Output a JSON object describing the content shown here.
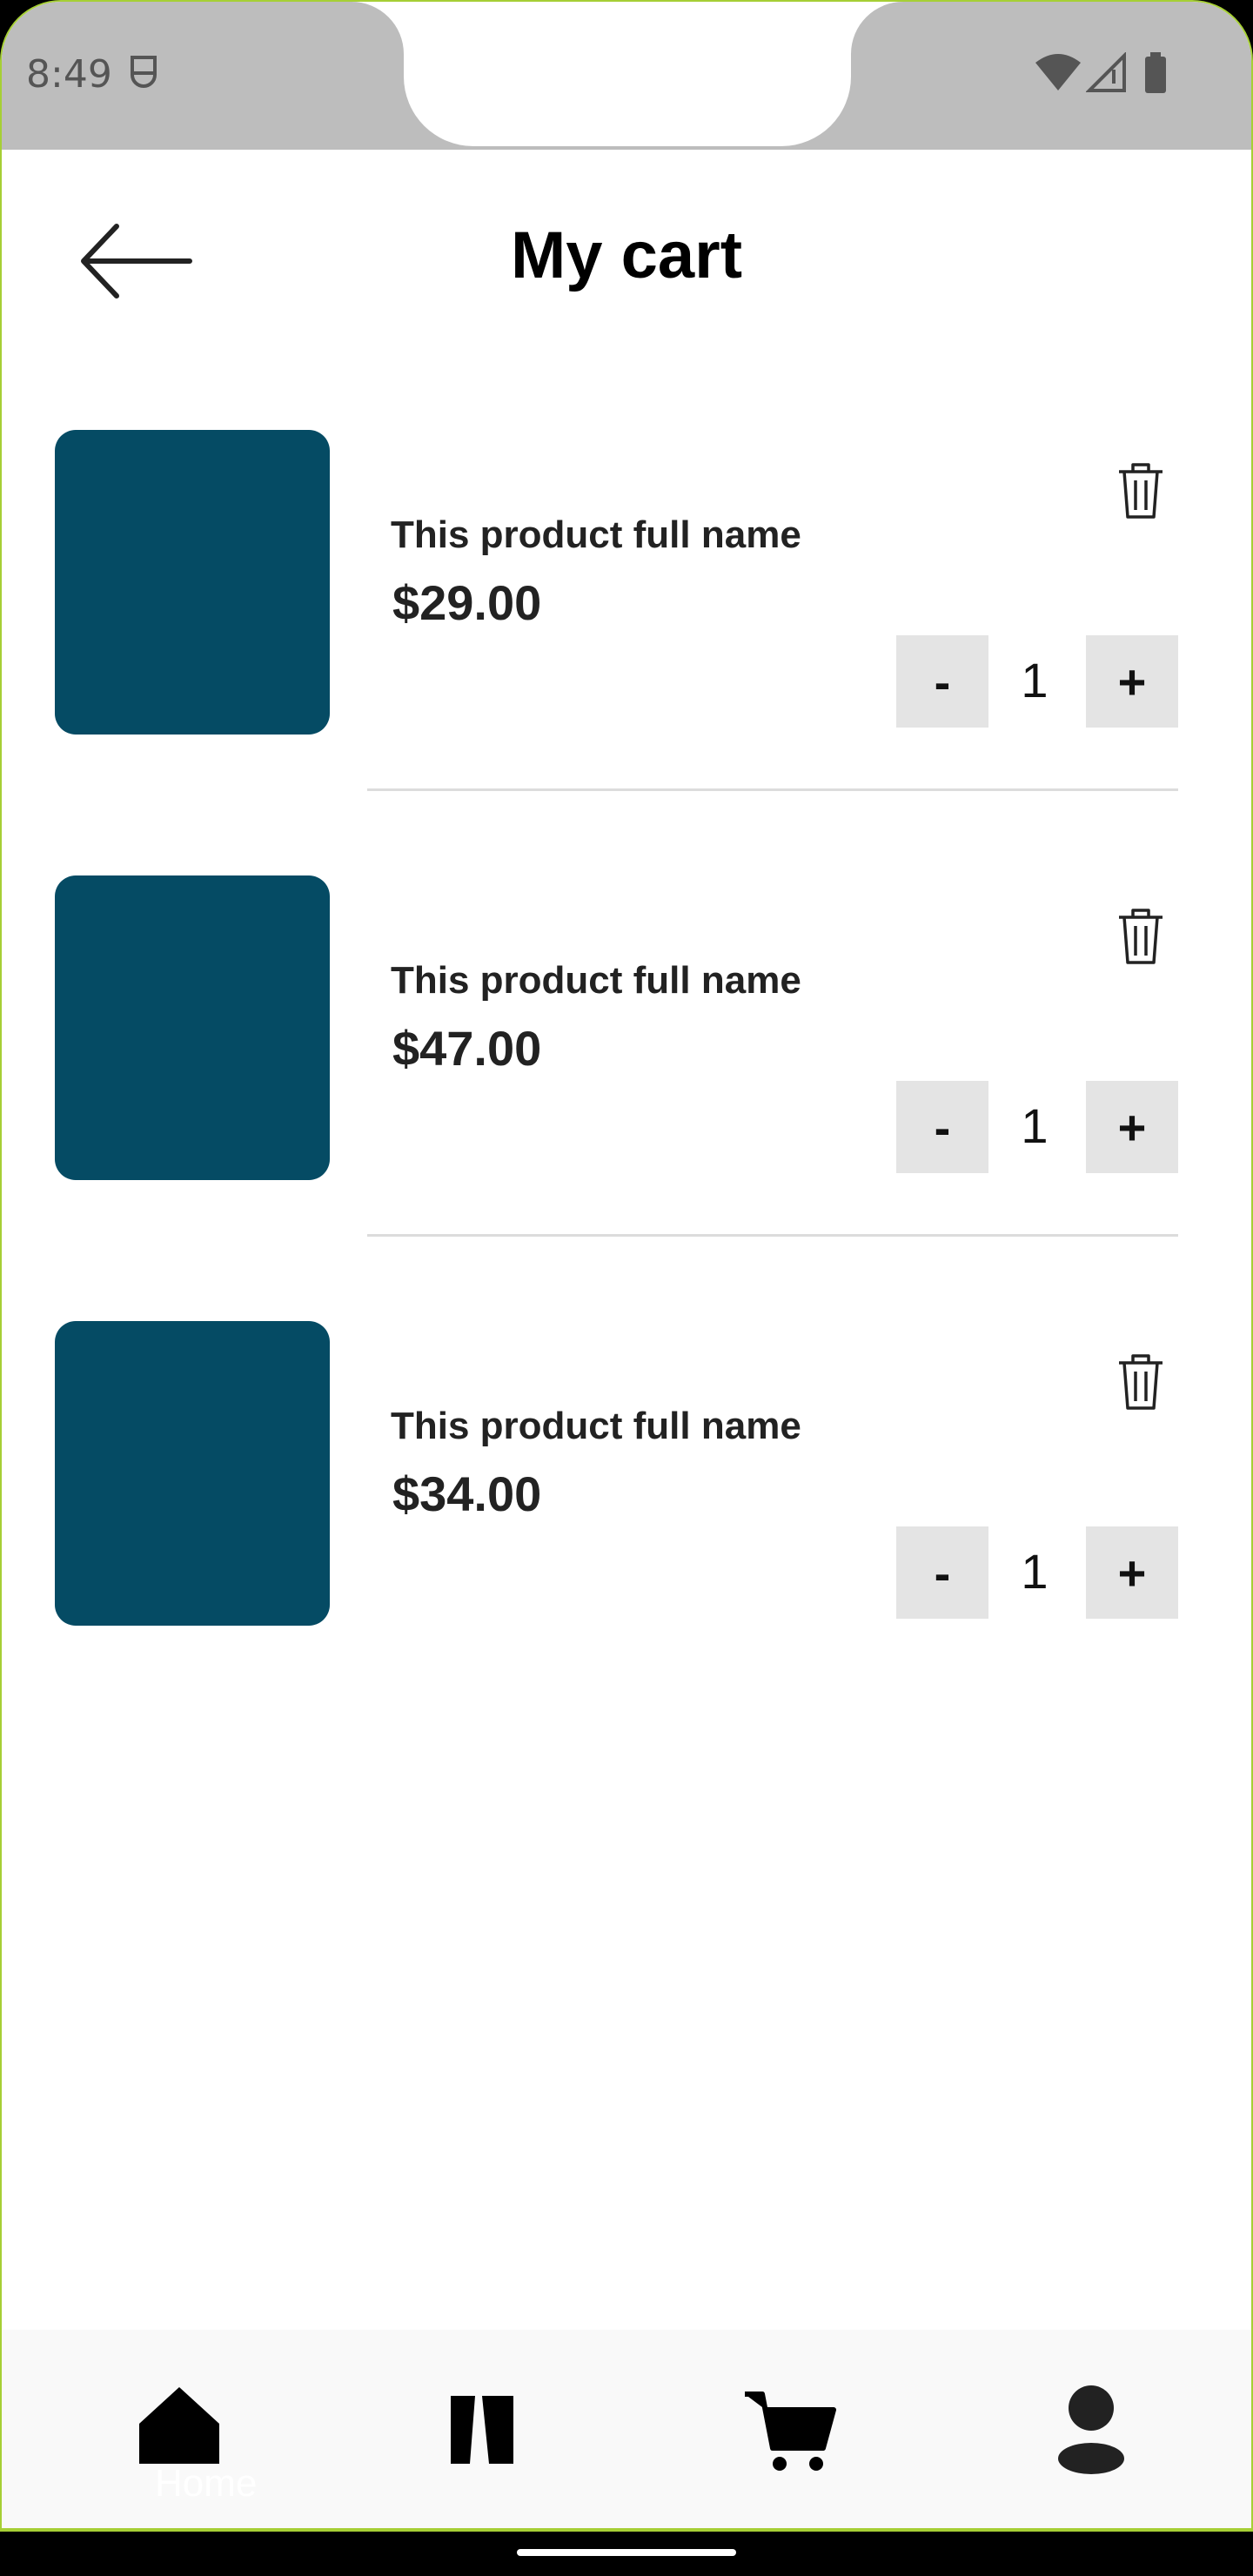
{
  "status_bar": {
    "time": "8:49"
  },
  "header": {
    "title": "My cart"
  },
  "cart_items": [
    {
      "name": "This product full name",
      "price": "$29.00",
      "quantity": "1",
      "minus_label": "-",
      "plus_label": "+"
    },
    {
      "name": "This product full name",
      "price": "$47.00",
      "quantity": "1",
      "minus_label": "-",
      "plus_label": "+"
    },
    {
      "name": "This product full name",
      "price": "$34.00",
      "quantity": "1",
      "minus_label": "-",
      "plus_label": "+"
    }
  ],
  "bottom_nav": {
    "home_label": "Home",
    "items": [
      "home-icon",
      "categories-icon",
      "cart-icon",
      "profile-icon"
    ]
  },
  "colors": {
    "accent": "#a6cf35",
    "thumbnail": "#054b64",
    "stepper_bg": "#e4e4e4"
  }
}
